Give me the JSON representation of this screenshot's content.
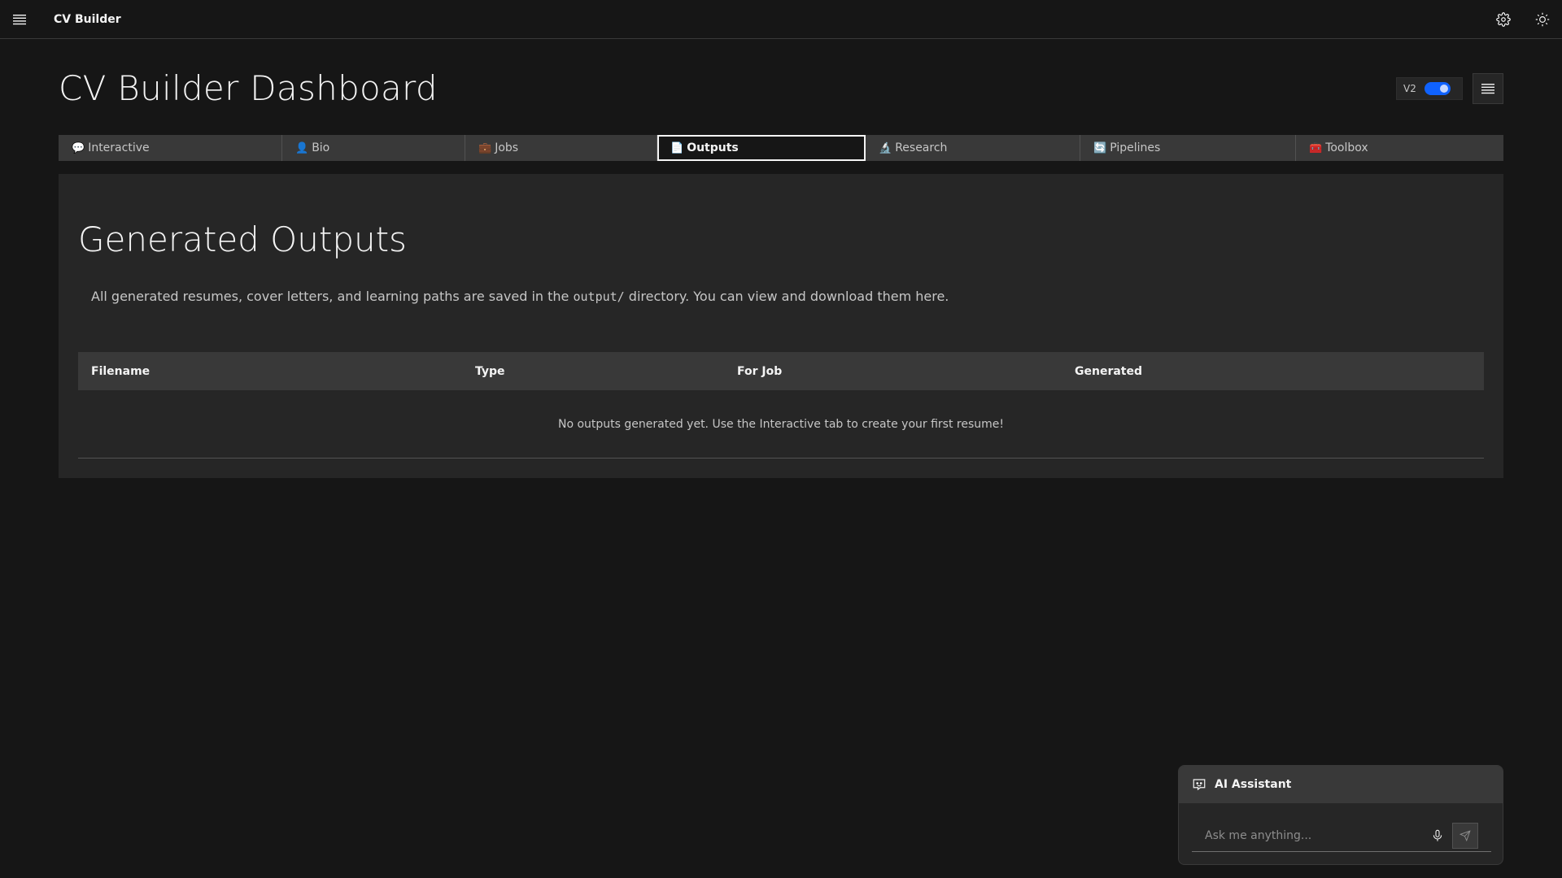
{
  "header": {
    "app_title": "CV Builder",
    "menu_icon": "hamburger-menu-icon",
    "settings_icon": "gear-icon",
    "theme_icon": "sun-icon"
  },
  "page": {
    "title": "CV Builder Dashboard",
    "version_label": "V2",
    "version_toggle_on": true
  },
  "tabs": [
    {
      "emoji": "💬",
      "label": "Interactive",
      "active": false
    },
    {
      "emoji": "👤",
      "label": "Bio",
      "active": false
    },
    {
      "emoji": "💼",
      "label": "Jobs",
      "active": false
    },
    {
      "emoji": "📄",
      "label": "Outputs",
      "active": true
    },
    {
      "emoji": "🔬",
      "label": "Research",
      "active": false
    },
    {
      "emoji": "🔄",
      "label": "Pipelines",
      "active": false
    },
    {
      "emoji": "🧰",
      "label": "Toolbox",
      "active": false
    }
  ],
  "outputs": {
    "title": "Generated Outputs",
    "desc_before": "All generated resumes, cover letters, and learning paths are saved in the ",
    "desc_code": "output/",
    "desc_after": " directory. You can view and download them here.",
    "columns": [
      "Filename",
      "Type",
      "For Job",
      "Generated"
    ],
    "empty_message": "No outputs generated yet. Use the Interactive tab to create your first resume!"
  },
  "assistant": {
    "title": "AI Assistant",
    "placeholder": "Ask me anything...",
    "input_value": ""
  },
  "colors": {
    "background": "#161616",
    "panel": "#262626",
    "accent": "#0f62fe"
  }
}
